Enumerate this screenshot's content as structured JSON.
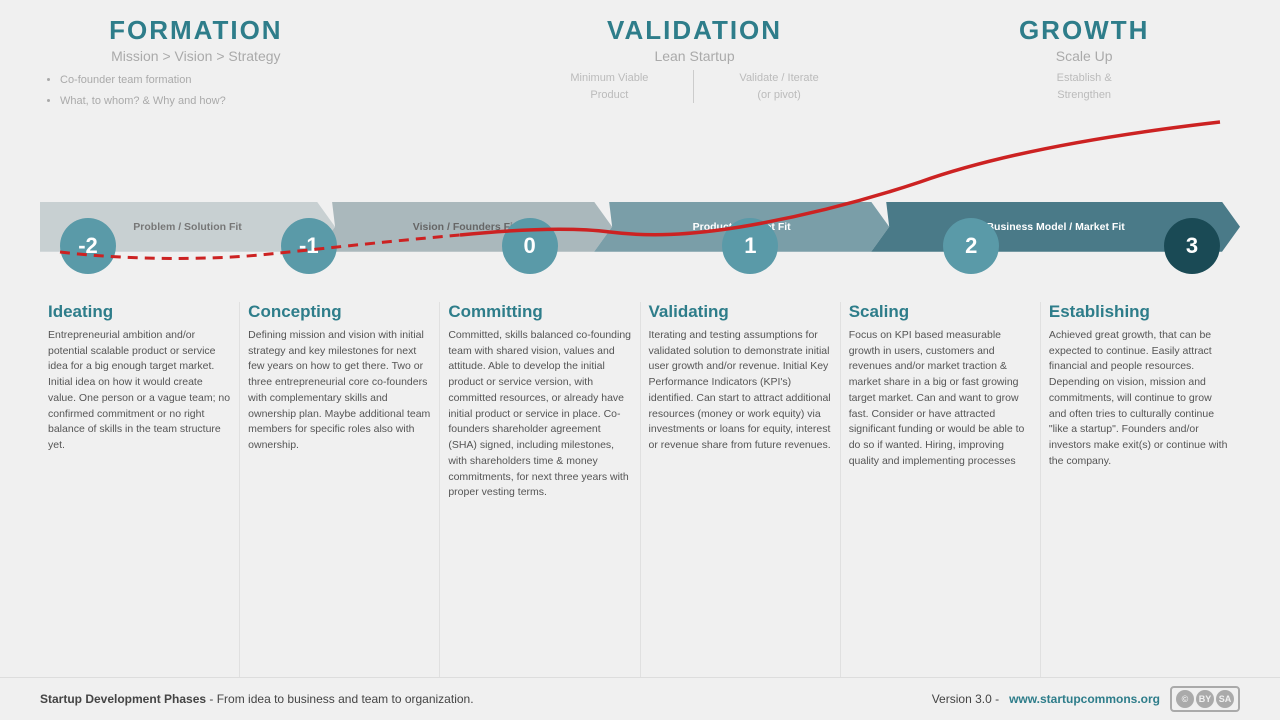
{
  "phases": {
    "formation": {
      "title": "FORMATION",
      "subtitle": "Mission  >  Vision  >  Strategy",
      "bullets": [
        "Co-founder team formation",
        "What, to whom? & Why and how?"
      ]
    },
    "validation": {
      "title": "VALIDATION",
      "subtitle": "Lean Startup",
      "desc1": "Minimum Viable\nProduct",
      "desc2": "Validate / Iterate\n(or pivot)"
    },
    "growth": {
      "title": "GROWTH",
      "subtitle": "Scale Up",
      "desc": "Establish &\nStrengthen"
    }
  },
  "stages": [
    {
      "number": "-2",
      "dark": false
    },
    {
      "number": "-1",
      "dark": false
    },
    {
      "number": "0",
      "dark": false
    },
    {
      "number": "1",
      "dark": false
    },
    {
      "number": "2",
      "dark": false
    },
    {
      "number": "3",
      "dark": true
    }
  ],
  "arrow_segments": [
    {
      "label": "Problem / Solution Fit",
      "color": "#c0c8ca"
    },
    {
      "label": "Vision / Founders Fit",
      "color": "#a8b4b8"
    },
    {
      "label": "Product / Market Fit",
      "color": "#7a9ea8"
    },
    {
      "label": "Business Model / Market Fit",
      "color": "#4a7a88"
    }
  ],
  "descriptions": [
    {
      "heading": "Ideating",
      "text": "Entrepreneurial ambition and/or potential scalable product or service idea for a big enough target market. Initial idea on how it would create value. One person or a vague team; no confirmed commitment or no right balance of skills in the team structure yet."
    },
    {
      "heading": "Concepting",
      "text": "Defining mission and vision with initial strategy and key milestones for next few years on how to get there. Two or three entrepreneurial core co-founders with complementary skills and ownership plan. Maybe additional team members for specific roles also with ownership."
    },
    {
      "heading": "Committing",
      "text": "Committed, skills balanced co-founding team with shared vision, values and attitude. Able to develop the initial product or service version, with committed resources, or already have initial product or service in place. Co-founders shareholder agreement (SHA) signed, including milestones, with shareholders time & money commitments, for next three years with proper vesting terms."
    },
    {
      "heading": "Validating",
      "text": "Iterating and testing assumptions for validated solution to demonstrate initial user growth and/or revenue. Initial Key Performance Indicators (KPI's) identified. Can start to attract additional resources (money or work equity) via investments or loans for equity, interest or revenue share from future revenues."
    },
    {
      "heading": "Scaling",
      "text": "Focus on KPI based measurable growth in users, customers and revenues and/or market traction & market share in a big or fast growing target market. Can and want to grow fast. Consider or have attracted significant funding or would be able to do so if wanted. Hiring, improving quality and implementing processes"
    },
    {
      "heading": "Establishing",
      "text": "Achieved great growth, that can be expected to continue. Easily attract financial and people resources. Depending on vision, mission and commitments, will continue to grow and often tries to culturally continue \"like a startup\". Founders and/or investors make exit(s) or continue with the company."
    }
  ],
  "footer": {
    "left_bold": "Startup Development Phases",
    "left_rest": " - From idea to business and team to organization.",
    "right_text": "Version 3.0  -  ",
    "right_link": "www.startupcommons.org"
  }
}
